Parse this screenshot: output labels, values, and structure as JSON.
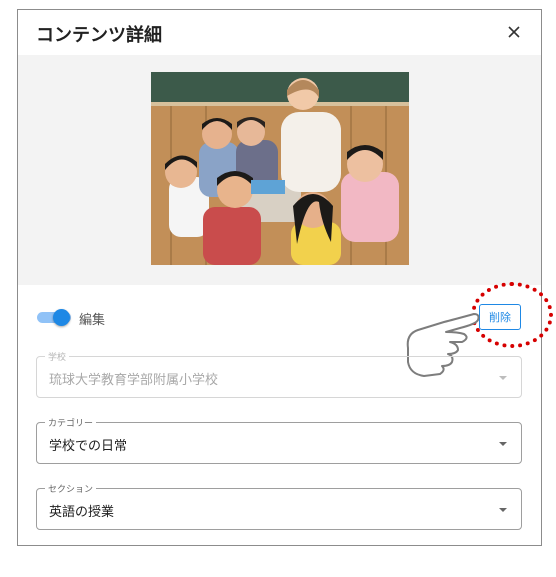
{
  "dialog": {
    "title": "コンテンツ詳細",
    "close_glyph": "×"
  },
  "photo": {
    "icon": "class-photo-image"
  },
  "edit": {
    "toggle_on": true,
    "label": "編集"
  },
  "delete_button": {
    "label": "削除"
  },
  "fields": {
    "school": {
      "label": "学校",
      "value": "琉球大学教育学部附属小学校",
      "disabled": true
    },
    "category": {
      "label": "カテゴリー",
      "value": "学校での日常",
      "disabled": false
    },
    "section": {
      "label": "セクション",
      "value": "英語の授業",
      "disabled": false
    }
  },
  "colors": {
    "accent": "#1e88e5",
    "highlight_ring": "#d60000"
  }
}
